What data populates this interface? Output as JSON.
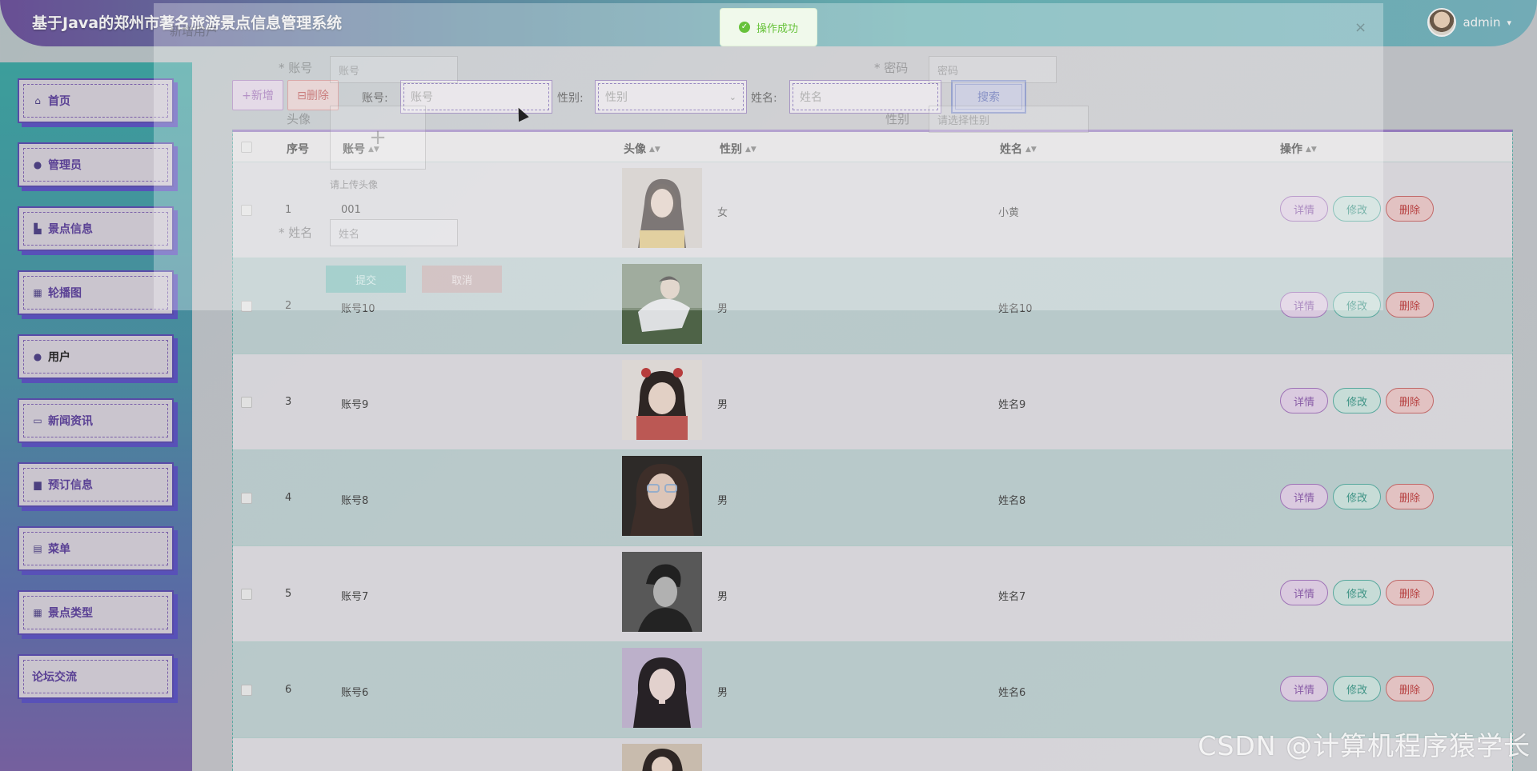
{
  "header": {
    "title": "基于Java的郑州市著名旅游景点信息管理系统",
    "username": "admin",
    "chevron": "▾"
  },
  "toast": {
    "text": "操作成功",
    "icon": "success-icon"
  },
  "sidebar": {
    "items": [
      {
        "label": "首页",
        "icon": "home-icon",
        "glyph": "⌂"
      },
      {
        "label": "管理员",
        "icon": "user-icon",
        "glyph": "●"
      },
      {
        "label": "景点信息",
        "icon": "building-icon",
        "glyph": "▙"
      },
      {
        "label": "轮播图",
        "icon": "image-icon",
        "glyph": "▦"
      },
      {
        "label": "用户",
        "icon": "person-icon",
        "glyph": "●"
      },
      {
        "label": "新闻资讯",
        "icon": "news-icon",
        "glyph": "▭"
      },
      {
        "label": "预订信息",
        "icon": "book-icon",
        "glyph": "▆"
      },
      {
        "label": "菜单",
        "icon": "menu-icon",
        "glyph": "▤"
      },
      {
        "label": "景点类型",
        "icon": "grid-icon",
        "glyph": "▦"
      },
      {
        "label": "论坛交流",
        "icon": "",
        "glyph": ""
      }
    ]
  },
  "toolbar": {
    "add_label": "+新增",
    "delete_label": "⊟删除",
    "account_label": "账号:",
    "account_placeholder": "账号",
    "gender_label": "性别:",
    "gender_placeholder": "性别",
    "name_label": "姓名:",
    "name_placeholder": "姓名",
    "search_label": "搜索"
  },
  "table": {
    "headers": {
      "index": "序号",
      "account": "账号",
      "avatar": "头像",
      "gender": "性别",
      "name": "姓名",
      "actions": "操作"
    },
    "sort_glyph": "▲▼",
    "actions": {
      "detail": "详情",
      "edit": "修改",
      "delete": "删除"
    },
    "rows": [
      {
        "index": "1",
        "account": "001",
        "gender": "女",
        "name": "小黄"
      },
      {
        "index": "2",
        "account": "账号10",
        "gender": "男",
        "name": "姓名10"
      },
      {
        "index": "3",
        "account": "账号9",
        "gender": "男",
        "name": "姓名9"
      },
      {
        "index": "4",
        "account": "账号8",
        "gender": "男",
        "name": "姓名8"
      },
      {
        "index": "5",
        "account": "账号7",
        "gender": "男",
        "name": "姓名7"
      },
      {
        "index": "6",
        "account": "账号6",
        "gender": "男",
        "name": "姓名6"
      }
    ]
  },
  "dialog_ghost": {
    "title": "新增用户",
    "account_label": "* 账号",
    "account_placeholder": "账号",
    "password_label": "* 密码",
    "password_placeholder": "密码",
    "avatar_label": "头像",
    "gender_label": "性别",
    "gender_placeholder": "请选择性别",
    "upload_hint": "请上传头像",
    "name_label": "* 姓名",
    "name_placeholder": "姓名",
    "submit_label": "提交",
    "cancel_label": "取消"
  },
  "watermark": "CSDN @计算机程序猿学长",
  "colors": {
    "accent_purple": "#8f5db0",
    "accent_teal": "#3c9b8b",
    "danger_red": "#c23d3d",
    "success_green": "#67c23a"
  }
}
